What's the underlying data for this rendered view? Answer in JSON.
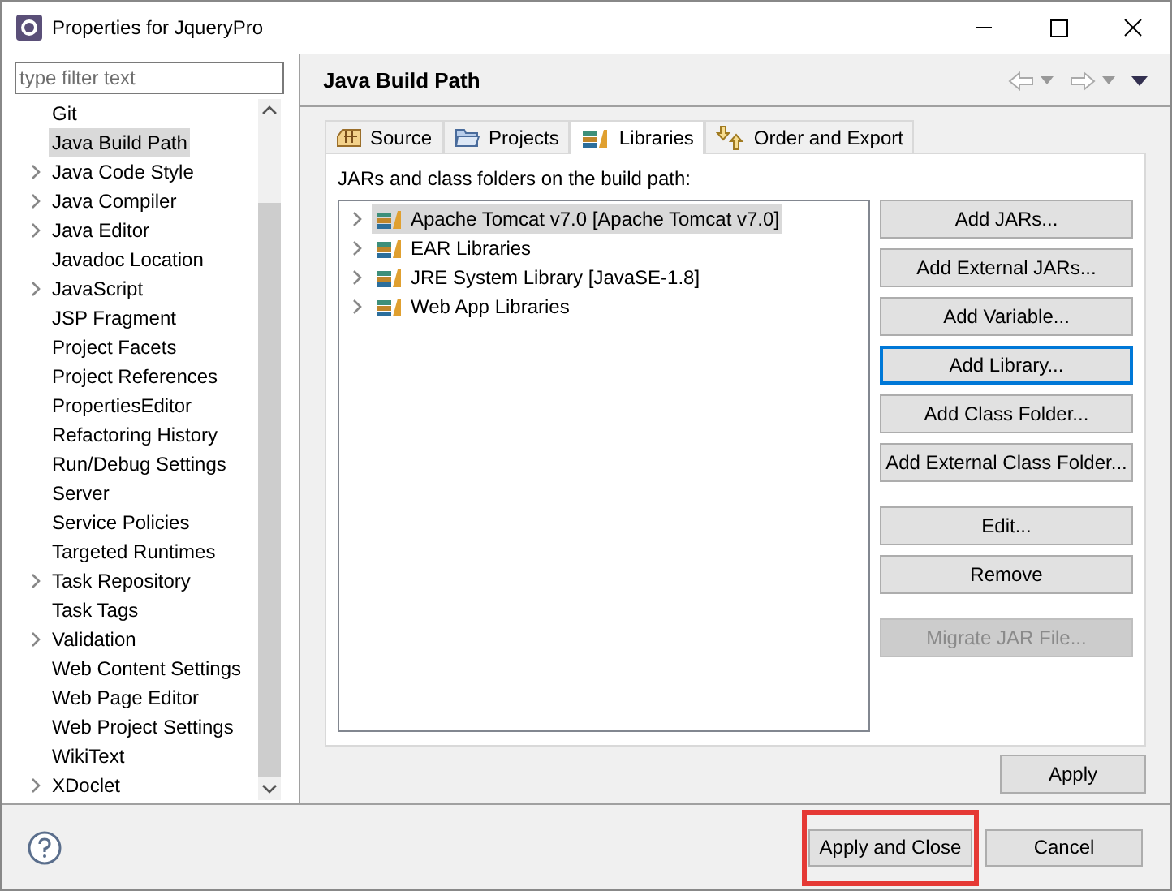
{
  "window": {
    "title": "Properties for JqueryPro"
  },
  "filter": {
    "placeholder": "type filter text"
  },
  "nav_items": [
    {
      "label": "Git",
      "expandable": false,
      "selected": false
    },
    {
      "label": "Java Build Path",
      "expandable": false,
      "selected": true
    },
    {
      "label": "Java Code Style",
      "expandable": true,
      "selected": false
    },
    {
      "label": "Java Compiler",
      "expandable": true,
      "selected": false
    },
    {
      "label": "Java Editor",
      "expandable": true,
      "selected": false
    },
    {
      "label": "Javadoc Location",
      "expandable": false,
      "selected": false
    },
    {
      "label": "JavaScript",
      "expandable": true,
      "selected": false
    },
    {
      "label": "JSP Fragment",
      "expandable": false,
      "selected": false
    },
    {
      "label": "Project Facets",
      "expandable": false,
      "selected": false
    },
    {
      "label": "Project References",
      "expandable": false,
      "selected": false
    },
    {
      "label": "PropertiesEditor",
      "expandable": false,
      "selected": false
    },
    {
      "label": "Refactoring History",
      "expandable": false,
      "selected": false
    },
    {
      "label": "Run/Debug Settings",
      "expandable": false,
      "selected": false
    },
    {
      "label": "Server",
      "expandable": false,
      "selected": false
    },
    {
      "label": "Service Policies",
      "expandable": false,
      "selected": false
    },
    {
      "label": "Targeted Runtimes",
      "expandable": false,
      "selected": false
    },
    {
      "label": "Task Repository",
      "expandable": true,
      "selected": false
    },
    {
      "label": "Task Tags",
      "expandable": false,
      "selected": false
    },
    {
      "label": "Validation",
      "expandable": true,
      "selected": false
    },
    {
      "label": "Web Content Settings",
      "expandable": false,
      "selected": false
    },
    {
      "label": "Web Page Editor",
      "expandable": false,
      "selected": false
    },
    {
      "label": "Web Project Settings",
      "expandable": false,
      "selected": false
    },
    {
      "label": "WikiText",
      "expandable": false,
      "selected": false
    },
    {
      "label": "XDoclet",
      "expandable": true,
      "selected": false
    }
  ],
  "page_title": "Java Build Path",
  "tabs": [
    {
      "label": "Source",
      "kind": "source",
      "selected": false
    },
    {
      "label": "Projects",
      "kind": "projects",
      "selected": false
    },
    {
      "label": "Libraries",
      "kind": "libraries",
      "selected": true
    },
    {
      "label": "Order and Export",
      "kind": "order",
      "selected": false
    }
  ],
  "libraries_label": "JARs and class folders on the build path:",
  "libraries": [
    {
      "label": "Apache Tomcat v7.0 [Apache Tomcat v7.0]",
      "selected": true
    },
    {
      "label": "EAR Libraries",
      "selected": false
    },
    {
      "label": "JRE System Library [JavaSE-1.8]",
      "selected": false
    },
    {
      "label": "Web App Libraries",
      "selected": false
    }
  ],
  "button_groups": [
    [
      {
        "label": "Add JARs...",
        "focused": false,
        "disabled": false
      },
      {
        "label": "Add External JARs...",
        "focused": false,
        "disabled": false
      },
      {
        "label": "Add Variable...",
        "focused": false,
        "disabled": false
      },
      {
        "label": "Add Library...",
        "focused": true,
        "disabled": false
      },
      {
        "label": "Add Class Folder...",
        "focused": false,
        "disabled": false
      },
      {
        "label": "Add External Class Folder...",
        "focused": false,
        "disabled": false
      }
    ],
    [
      {
        "label": "Edit...",
        "focused": false,
        "disabled": false
      },
      {
        "label": "Remove",
        "focused": false,
        "disabled": false
      }
    ],
    [
      {
        "label": "Migrate JAR File...",
        "focused": false,
        "disabled": true
      }
    ]
  ],
  "apply_button": "Apply",
  "footer_buttons": [
    {
      "label": "Apply and Close",
      "highlighted": true
    },
    {
      "label": "Cancel",
      "highlighted": false
    }
  ]
}
